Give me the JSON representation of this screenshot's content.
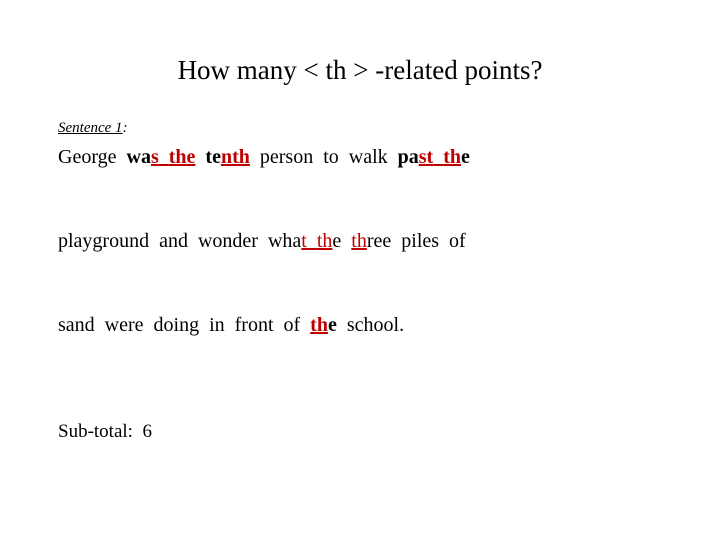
{
  "slide": {
    "background_color": "#ffffff",
    "text_color": "#000000",
    "highlight_color": "#C00000"
  },
  "title": "How many < th > -related points?",
  "sentence": {
    "label": "Sentence 1",
    "label_colon": ":",
    "lines": [
      {
        "id": "line-1",
        "plain_text": "George  was  the  tenth  person  to  walk  past  the"
      },
      {
        "id": "line-2",
        "plain_text": "playground  and  wonder  what  the  three  piles  of"
      },
      {
        "id": "line-3",
        "plain_text": "sand  were  doing  in  front  of  the  school."
      }
    ],
    "runs": {
      "l1_george": "George",
      "l1_sp1": "  ",
      "l1_wa": "wa",
      "l1_s": "s",
      "l1_gap1": "  ",
      "l1_the": "the",
      "l1_sp2": "  ",
      "l1_te": "te",
      "l1_nth": "nth",
      "l1_sp3": "  person  to  walk  ",
      "l1_pa": "pa",
      "l1_st": "st",
      "l1_gap2": "  ",
      "l1_th": "th",
      "l1_e": "e",
      "l2_start": "playground  and  wonder  wha",
      "l2_t": "t",
      "l2_gap1": "  ",
      "l2_th": "th",
      "l2_e": "e",
      "l2_sp": "  ",
      "l2_th2": "th",
      "l2_ree": "ree  piles  of",
      "l3_start": "sand  were  doing  in  front  of  ",
      "l3_th": "th",
      "l3_e": "e",
      "l3_end": "  school."
    }
  },
  "subtotal": {
    "label": "Sub-total:",
    "value": "6",
    "display": "Sub-total:  6"
  }
}
